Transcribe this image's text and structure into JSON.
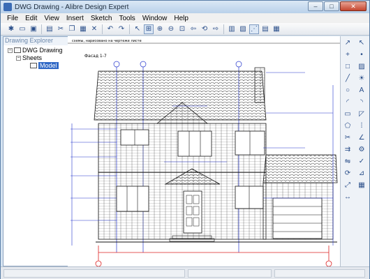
{
  "window": {
    "title": "DWG Drawing - Alibre Design Expert",
    "min": "–",
    "max": "□",
    "close": "✕"
  },
  "menu": [
    "File",
    "Edit",
    "View",
    "Insert",
    "Sketch",
    "Tools",
    "Window",
    "Help"
  ],
  "toolbar_icons": [
    "new-icon",
    "open-icon",
    "save-icon",
    "print-icon",
    "cut-icon",
    "copy-icon",
    "paste-icon",
    "delete-icon",
    "undo-icon",
    "redo-icon",
    "select-icon",
    "zoom-window-icon",
    "zoom-in-icon",
    "zoom-out-icon",
    "zoom-fit-icon",
    "pan-icon",
    "rotate-icon",
    "view-icon",
    "grid-icon",
    "snap-icon",
    "layer-icon"
  ],
  "explorer": {
    "header": "Drawing Explorer",
    "root": "DWG Drawing",
    "sheets": "Sheets",
    "model": "Model"
  },
  "drawing": {
    "title": "Фасад 1-7",
    "note": "схемы, нарисовано на чертеже листе"
  },
  "right_tools_left": [
    "arrow-icon",
    "plus-icon",
    "square-icon",
    "line-icon",
    "circle-icon",
    "arc-icon",
    "rect-icon",
    "polygon-icon",
    "trim-icon",
    "offset-icon",
    "mirror-icon",
    "rotate-icon",
    "scale-icon",
    "dimension-icon"
  ],
  "right_tools_right": [
    "cursor-icon",
    "point-icon",
    "hatch-icon",
    "bulb-icon",
    "text-icon",
    "fillet-icon",
    "chamfer-icon",
    "array-icon",
    "angle-icon",
    "gear-icon",
    "check-icon",
    "measure-icon",
    "grid-icon"
  ]
}
